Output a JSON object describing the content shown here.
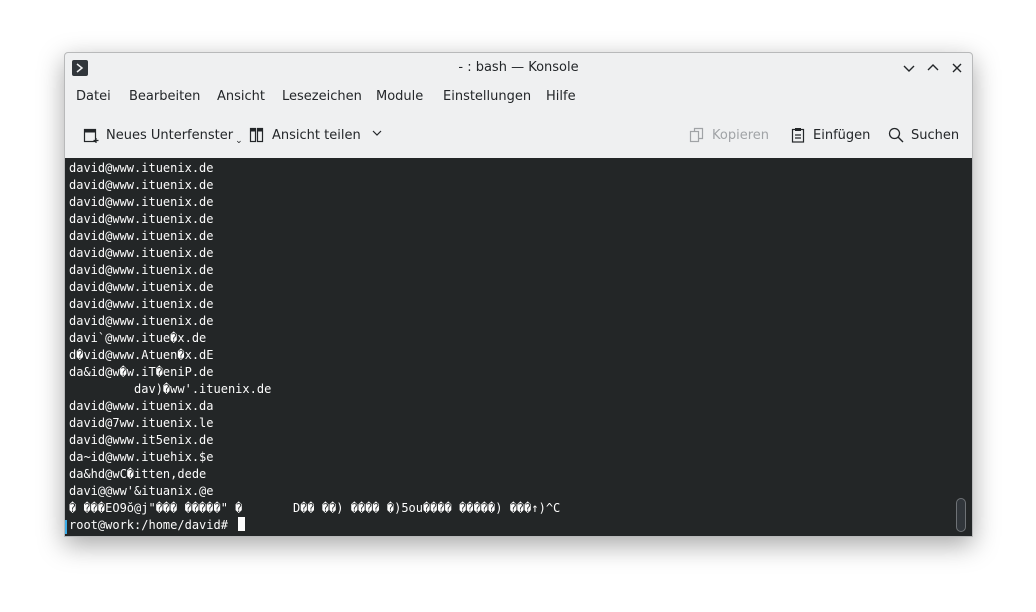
{
  "window": {
    "title": "- : bash — Konsole"
  },
  "menubar": {
    "items": [
      "Datei",
      "Bearbeiten",
      "Ansicht",
      "Lesezeichen",
      "Module",
      "Einstellungen",
      "Hilfe"
    ]
  },
  "toolbar": {
    "new_tab_label": "Neues Unterfenster",
    "split_view_label": "Ansicht teilen",
    "copy_label": "Kopieren",
    "paste_label": "Einfügen",
    "find_label": "Suchen"
  },
  "terminal": {
    "lines": [
      "david@www.ituenix.de",
      "david@www.ituenix.de",
      "david@www.ituenix.de",
      "david@www.ituenix.de",
      "david@www.ituenix.de",
      "david@www.ituenix.de",
      "david@www.ituenix.de",
      "david@www.ituenix.de",
      "david@www.ituenix.de",
      "david@www.ituenix.de",
      "davi`@www.itue�x.de",
      "d�vid@www.Atuen�x.dE",
      "da&id@w�w.iT�eniP.de",
      "         dav)�ww'.ituenix.de",
      "david@www.ituenix.da",
      "david@7ww.ituenix.le",
      "david@www.it5enix.de",
      "da~id@www.ituehix.$e",
      "da&hd@wC�itten,dede",
      "davi@@ww'&ituanix.@e",
      "� ���EO9ŏ@j\"��� �����\" �       D�� ��) ���� �)5ou���� �����) ���↑)^C"
    ],
    "prompt": "root@work:/home/david# "
  }
}
